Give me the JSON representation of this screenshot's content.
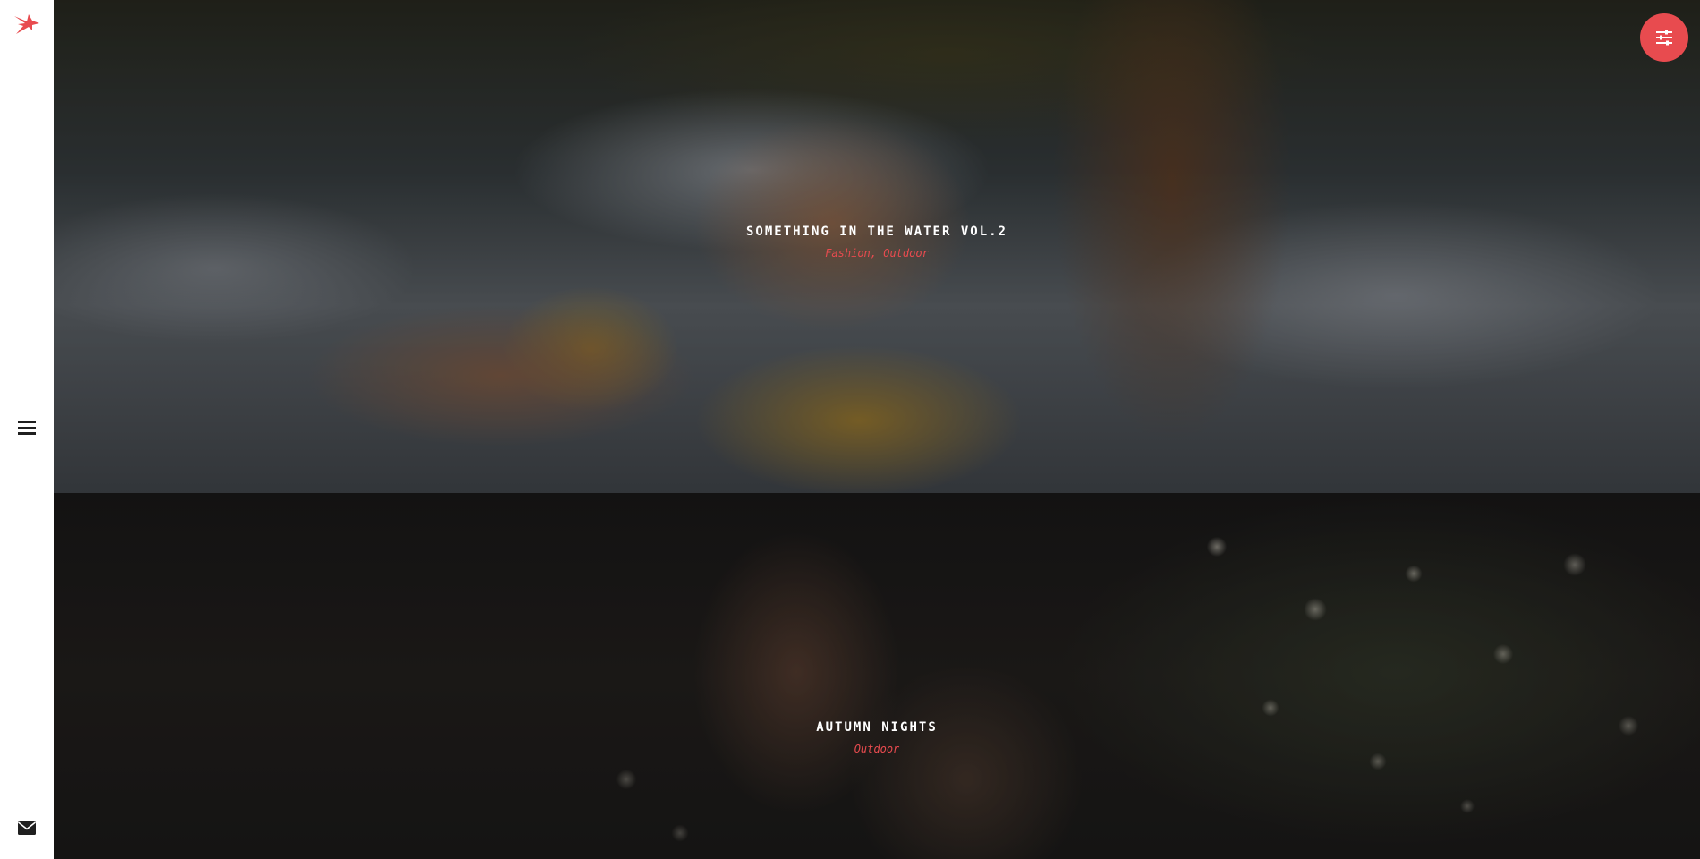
{
  "brand": {
    "accent_color": "#e84b4f",
    "logo_icon": "bird-icon"
  },
  "sidebar": {
    "menu_icon": "hamburger-menu-icon",
    "contact_icon": "envelope-icon"
  },
  "settings_button": {
    "icon": "sliders-icon"
  },
  "projects": [
    {
      "title": "SOMETHING IN THE WATER VOL.2",
      "tags": "Fashion, Outdoor"
    },
    {
      "title": "AUTUMN NIGHTS",
      "tags": "Outdoor"
    }
  ]
}
